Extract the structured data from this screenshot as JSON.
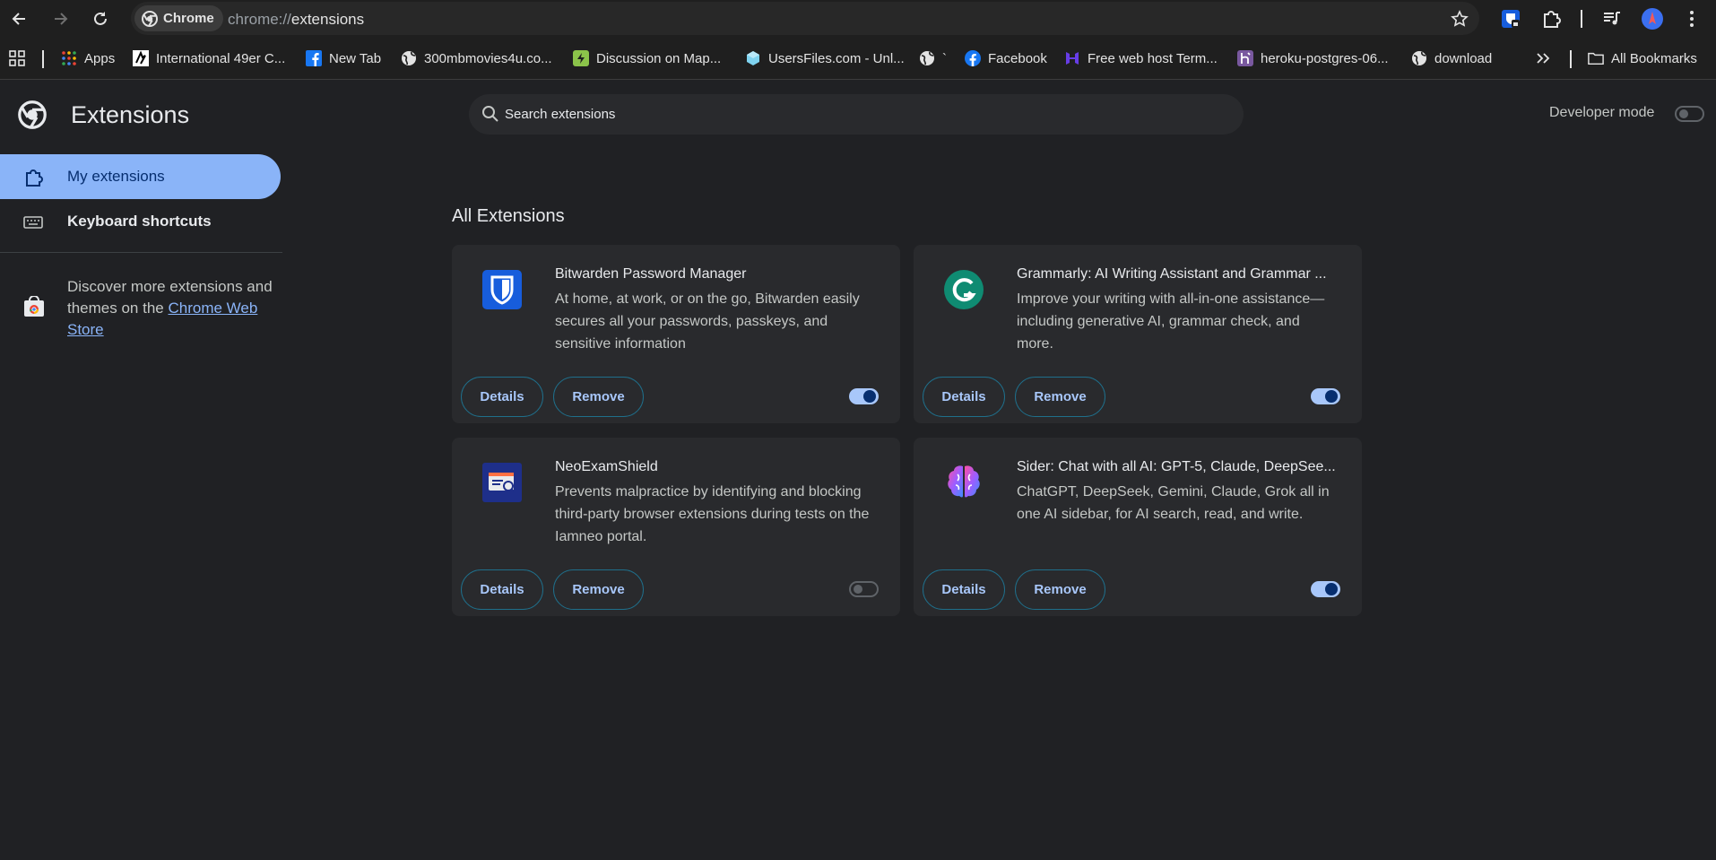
{
  "browser": {
    "site_chip": "Chrome",
    "url_scheme": "chrome://",
    "url_path": "extensions"
  },
  "bookmarks": [
    {
      "label": "Apps",
      "icon": "apps-grid-icon"
    },
    {
      "label": "International 49er C...",
      "icon": "49er-favicon"
    },
    {
      "label": "New Tab",
      "icon": "facebook-favicon"
    },
    {
      "label": "300mbmovies4u.co...",
      "icon": "globe-favicon"
    },
    {
      "label": "Discussion on Map...",
      "icon": "discussion-favicon"
    },
    {
      "label": "UsersFiles.com - Unl...",
      "icon": "usersfiles-favicon"
    },
    {
      "label": "`",
      "icon": "globe-favicon"
    },
    {
      "label": "Facebook",
      "icon": "facebook-favicon"
    },
    {
      "label": "Free web host Term...",
      "icon": "webhost-favicon"
    },
    {
      "label": "heroku-postgres-06...",
      "icon": "heroku-favicon"
    },
    {
      "label": "download",
      "icon": "globe-favicon"
    }
  ],
  "all_bookmarks_label": "All Bookmarks",
  "page": {
    "title": "Extensions",
    "search_placeholder": "Search extensions",
    "developer_mode_label": "Developer mode",
    "developer_mode": false
  },
  "sidebar": {
    "items": [
      {
        "label": "My extensions",
        "active": true
      },
      {
        "label": "Keyboard shortcuts",
        "active": false
      }
    ],
    "discover_text": "Discover more extensions and themes on the",
    "discover_link": "Chrome Web Store"
  },
  "section_title": "All Extensions",
  "extensions": [
    {
      "name": "Bitwarden Password Manager",
      "description": "At home, at work, or on the go, Bitwarden easily secures all your passwords, passkeys, and sensitive information",
      "enabled": true,
      "details_label": "Details",
      "remove_label": "Remove",
      "icon": "bitwarden-shield-icon"
    },
    {
      "name": "Grammarly: AI Writing Assistant and Grammar ...",
      "description": "Improve your writing with all-in-one assistance—including generative AI, grammar check, and more.",
      "enabled": true,
      "details_label": "Details",
      "remove_label": "Remove",
      "icon": "grammarly-g-icon"
    },
    {
      "name": "NeoExamShield",
      "description": "Prevents malpractice by identifying and blocking third-party browser extensions during tests on the Iamneo portal.",
      "enabled": false,
      "details_label": "Details",
      "remove_label": "Remove",
      "icon": "neoexamshield-icon"
    },
    {
      "name": "Sider: Chat with all AI: GPT-5, Claude, DeepSee...",
      "description": "ChatGPT, DeepSeek, Gemini, Claude, Grok all in one AI sidebar, for AI search, read, and write.",
      "enabled": true,
      "details_label": "Details",
      "remove_label": "Remove",
      "icon": "sider-brain-icon"
    }
  ]
}
